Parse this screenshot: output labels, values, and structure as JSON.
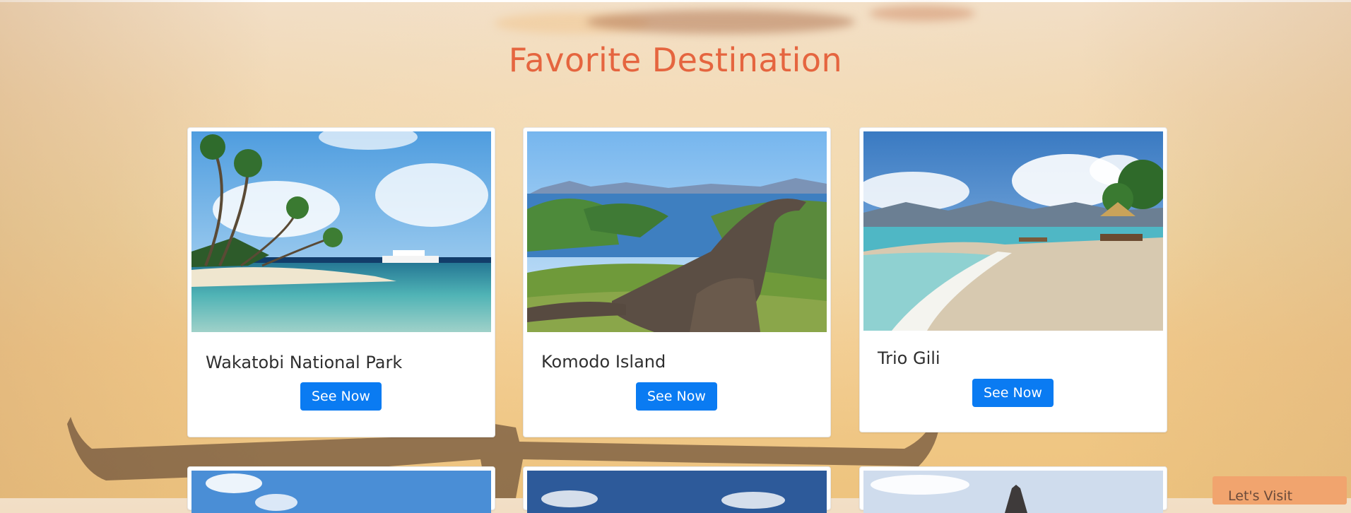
{
  "page": {
    "title": "Favorite Destination",
    "title_color": "#e5653f"
  },
  "destinations": [
    {
      "name": "Wakatobi National Park",
      "button_label": "See Now",
      "image": "tropical-beach-with-palm-trees-and-boat"
    },
    {
      "name": "Komodo Island",
      "button_label": "See Now",
      "image": "komodo-dragons-on-green-hills"
    },
    {
      "name": "Trio Gili",
      "button_label": "See Now",
      "image": "sandy-beach-with-mountains"
    }
  ],
  "more_destinations": [
    {
      "image": "blue-sky-with-clouds"
    },
    {
      "image": "dark-blue-sky-with-clouds"
    },
    {
      "image": "pale-sky-with-temple-silhouette"
    }
  ],
  "floating_button": {
    "label": "Let's Visit"
  },
  "colors": {
    "button": "#0a7bf2",
    "background": "#f1d7b1",
    "floating_button": "#f1a46e"
  }
}
